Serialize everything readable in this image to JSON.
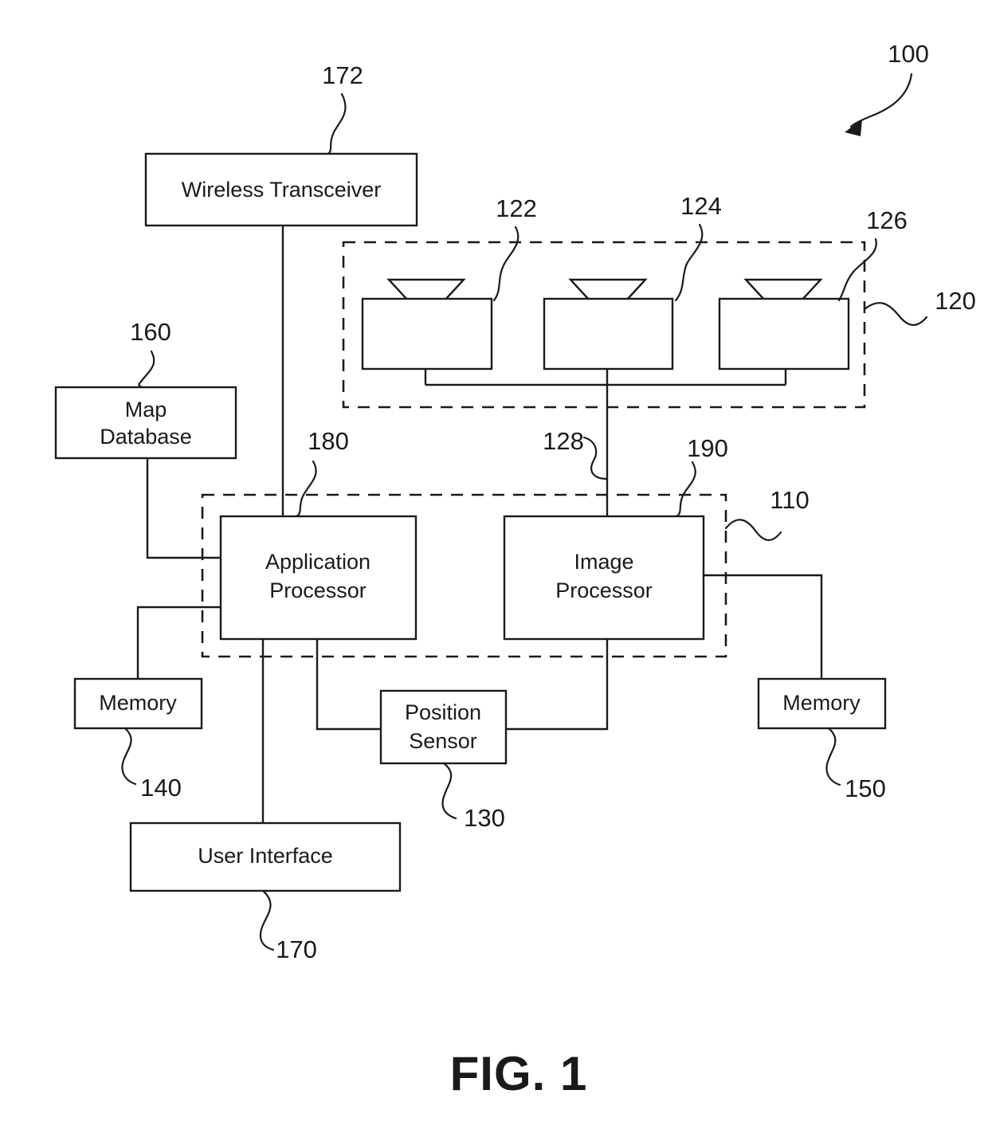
{
  "figure": {
    "caption": "FIG. 1",
    "system_reference": "100"
  },
  "blocks": {
    "wireless_transceiver": {
      "label": "Wireless Transceiver",
      "ref": "172"
    },
    "map_database": {
      "label_line1": "Map",
      "label_line2": "Database",
      "ref": "160"
    },
    "application_processor": {
      "label_line1": "Application",
      "label_line2": "Processor",
      "ref": "180"
    },
    "image_processor": {
      "label_line1": "Image",
      "label_line2": "Processor",
      "ref": "190"
    },
    "memory_left": {
      "label": "Memory",
      "ref": "140"
    },
    "memory_right": {
      "label": "Memory",
      "ref": "150"
    },
    "position_sensor": {
      "label_line1": "Position",
      "label_line2": "Sensor",
      "ref": "130"
    },
    "user_interface": {
      "label": "User Interface",
      "ref": "170"
    }
  },
  "image_capture_unit": {
    "ref": "120",
    "bus_ref": "128",
    "cameras": [
      {
        "ref": "122"
      },
      {
        "ref": "124"
      },
      {
        "ref": "126"
      }
    ]
  },
  "processing_unit": {
    "ref": "110"
  }
}
